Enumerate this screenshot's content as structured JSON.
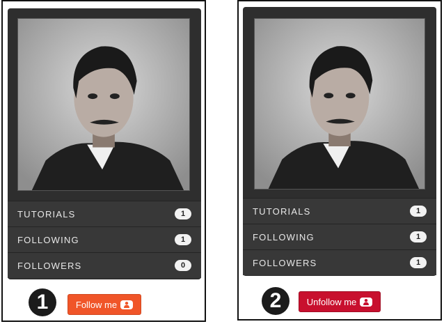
{
  "panels": [
    {
      "step": "1",
      "stats": [
        {
          "label": "TUTORIALS",
          "count": "1"
        },
        {
          "label": "FOLLOWING",
          "count": "1"
        },
        {
          "label": "FOLLOWERS",
          "count": "0"
        }
      ],
      "button": {
        "label": "Follow me",
        "icon": "user-icon",
        "color": "#f05528"
      }
    },
    {
      "step": "2",
      "stats": [
        {
          "label": "TUTORIALS",
          "count": "1"
        },
        {
          "label": "FOLLOWING",
          "count": "1"
        },
        {
          "label": "FOLLOWERS",
          "count": "1"
        }
      ],
      "button": {
        "label": "Unfollow me",
        "icon": "user-icon",
        "color": "#c8102e"
      }
    }
  ]
}
